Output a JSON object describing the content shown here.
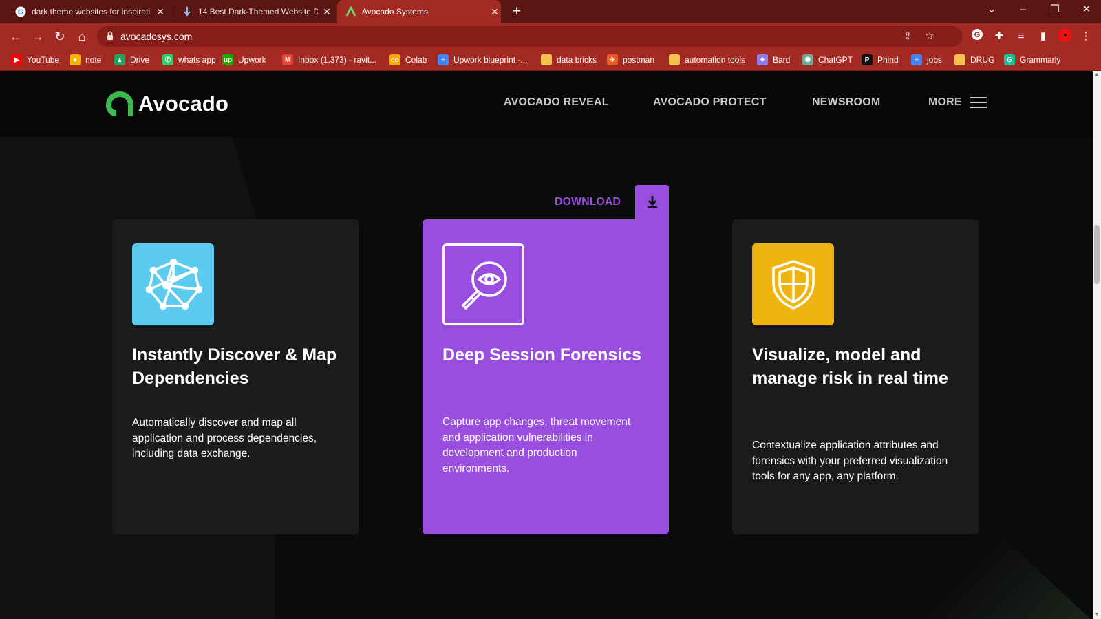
{
  "browser": {
    "tabs": [
      {
        "title": "dark theme websites for inspirati",
        "favicon": "google-icon",
        "active": false
      },
      {
        "title": "14 Best Dark-Themed Website D",
        "favicon": "download-arrow-icon",
        "active": false
      },
      {
        "title": "Avocado Systems",
        "favicon": "avocado-icon",
        "active": true
      }
    ],
    "url": "avocadosys.com",
    "accent_color": "#a32a22"
  },
  "bookmarks": [
    {
      "label": "YouTube",
      "icon": "youtube-icon",
      "color": "#ff0000"
    },
    {
      "label": "note",
      "icon": "keep-icon",
      "color": "#f6b400"
    },
    {
      "label": "Drive",
      "icon": "drive-icon",
      "color": "#1fa463"
    },
    {
      "label": "whats app",
      "icon": "whatsapp-icon",
      "color": "#25d366"
    },
    {
      "label": "Upwork",
      "icon": "upwork-icon",
      "color": "#14a800"
    },
    {
      "label": "Inbox (1,373) - ravit...",
      "icon": "gmail-icon",
      "color": "#ea4335"
    },
    {
      "label": "Colab",
      "icon": "colab-icon",
      "color": "#f9ab00"
    },
    {
      "label": "Upwork blueprint -...",
      "icon": "docs-icon",
      "color": "#4285f4"
    },
    {
      "label": "data bricks",
      "icon": "folder-icon",
      "color": "#f4c24d"
    },
    {
      "label": "postman",
      "icon": "postman-icon",
      "color": "#ef5b25"
    },
    {
      "label": "automation tools",
      "icon": "folder-icon",
      "color": "#f4c24d"
    },
    {
      "label": "Bard",
      "icon": "bard-icon",
      "color": "#8e7cf0"
    },
    {
      "label": "ChatGPT",
      "icon": "chatgpt-icon",
      "color": "#74aa9c"
    },
    {
      "label": "Phind",
      "icon": "phind-icon",
      "color": "#111111"
    },
    {
      "label": "jobs",
      "icon": "docs-icon",
      "color": "#4285f4"
    },
    {
      "label": "DRUG",
      "icon": "folder-icon",
      "color": "#f4c24d"
    },
    {
      "label": "Grammarly",
      "icon": "grammarly-icon",
      "color": "#15c39a"
    }
  ],
  "site": {
    "brand": "Avocado",
    "brand_color": "#3dba4e",
    "nav": [
      "AVOCADO REVEAL",
      "AVOCADO PROTECT",
      "NEWSROOM",
      "MORE"
    ],
    "download_label": "DOWNLOAD",
    "cards": [
      {
        "title": "Instantly Discover & Map Dependencies",
        "description": "Automatically discover and map all application and process dependencies, including data exchange.",
        "icon": "network-graph-icon",
        "icon_bg": "#5bcbf0"
      },
      {
        "title": "Deep Session Forensics",
        "description": "Capture app changes, threat movement and application vulnerabilities in development and production environments.",
        "icon": "magnifier-eye-icon",
        "icon_bg": "#9a4ee0"
      },
      {
        "title": "Visualize, model and manage risk in real time",
        "description": "Contextualize application attributes and forensics with your preferred visualization tools for any app, any platform.",
        "icon": "shield-icon",
        "icon_bg": "#efb40f"
      }
    ]
  }
}
